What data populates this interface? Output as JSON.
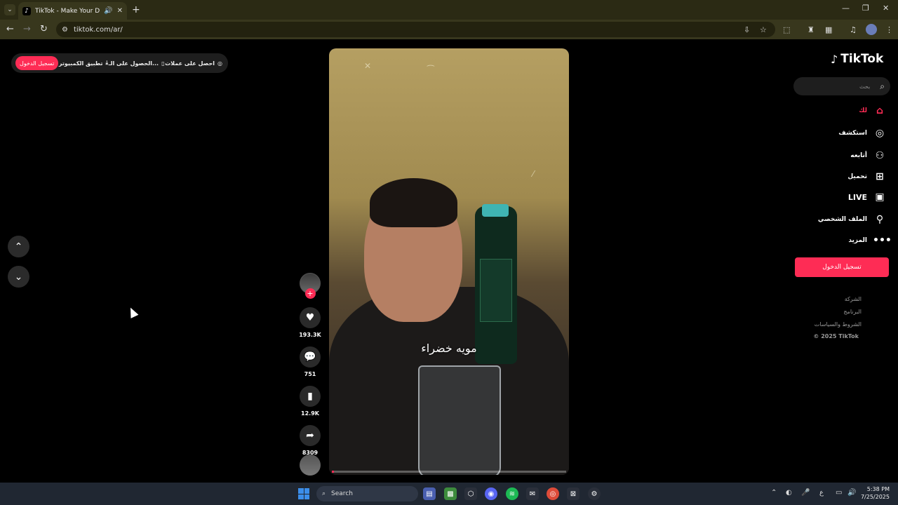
{
  "browser": {
    "tab_title": "TikTok - Make Your Day",
    "url": "tiktok.com/ar/"
  },
  "topbar": {
    "login": "تسجيل الدخول",
    "desktop_app": "تطبيق الكمبيوتر",
    "get_app": "الحصول على الـ...",
    "get_coins": "احصل على عملات"
  },
  "sidebar": {
    "brand": "TikTok",
    "search_placeholder": "بحث",
    "items": [
      {
        "label": "لك",
        "icon": "home-icon",
        "active": true
      },
      {
        "label": "استكشف",
        "icon": "compass-icon"
      },
      {
        "label": "أتابعه",
        "icon": "user-follow-icon"
      },
      {
        "label": "تحميل",
        "icon": "upload-icon"
      },
      {
        "label": "LIVE",
        "icon": "live-icon"
      },
      {
        "label": "الملف الشخصي",
        "icon": "profile-icon"
      },
      {
        "label": "المزيد",
        "icon": "more-icon"
      }
    ],
    "login_button": "تسجيل الدخول",
    "footer": [
      "الشركة",
      "البرنامج",
      "الشروط والسياسات",
      "© 2025 TikTok"
    ]
  },
  "video": {
    "caption": "مويه خضراء",
    "progress": 0.01
  },
  "actions": {
    "likes": "193.3K",
    "comments": "751",
    "saves": "12.9K",
    "shares": "8309"
  },
  "taskbar": {
    "search_label": "Search",
    "time": "5:38 PM",
    "date": "7/25/2025",
    "lang": "ع"
  },
  "colors": {
    "accent": "#fe2c55",
    "chrome": "#38371d"
  }
}
